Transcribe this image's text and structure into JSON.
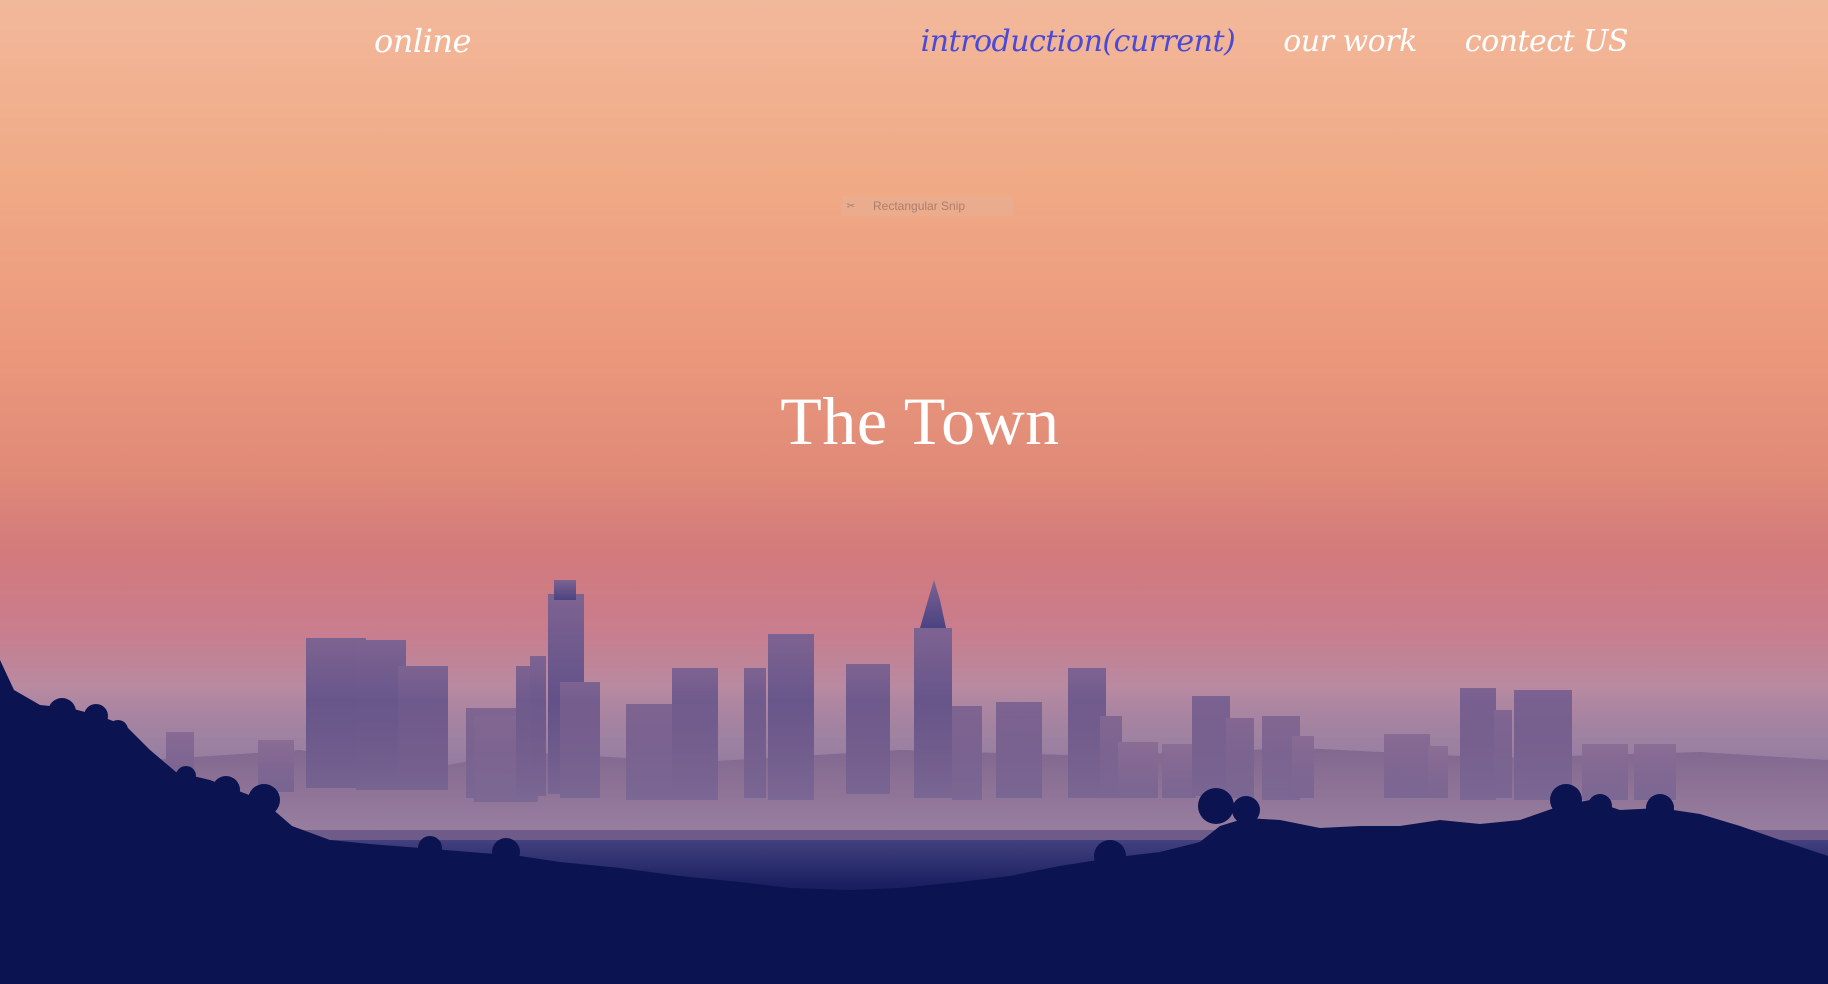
{
  "nav": {
    "logo": "online",
    "links": [
      {
        "label": "introduction(current)",
        "current": true
      },
      {
        "label": "our work",
        "current": false
      },
      {
        "label": "contect US",
        "current": false
      }
    ]
  },
  "snip_toolbar": {
    "label": "Rectangular Snip",
    "icon": "scissors-icon"
  },
  "hero": {
    "title": "The Town"
  },
  "colors": {
    "sky_top": "#f2b89b",
    "sky_mid": "#e08a78",
    "haze": "#c97d8d",
    "city": "#6f5a86",
    "hills": "#08114e",
    "active_link": "#4a4ad6"
  }
}
